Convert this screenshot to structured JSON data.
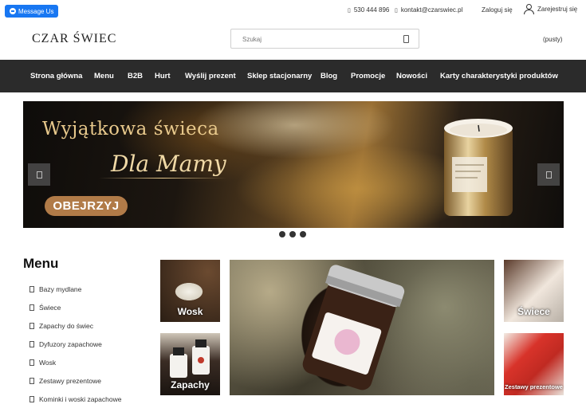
{
  "messenger": {
    "label": "Message Us"
  },
  "topbar": {
    "phone": "530 444 896",
    "email": "kontakt@czarswiec.pl",
    "login": "Zaloguj się",
    "register": "Zarejestruj się"
  },
  "header": {
    "logo": "CZAR ŚWIEC",
    "search_placeholder": "Szukaj",
    "cart": "(pusty)"
  },
  "nav": {
    "items": [
      "Strona główna",
      "Menu",
      "B2B",
      "Hurt",
      "Wyślij prezent",
      "Sklep stacjonarny",
      "Blog",
      "Promocje",
      "Nowości",
      "Karty charakterystyki produktów"
    ]
  },
  "banner": {
    "title": "Wyjątkowa świeca",
    "subtitle": "Dla Mamy",
    "button": "OBEJRZYJ"
  },
  "sidebar": {
    "title": "Menu",
    "items": [
      "Bazy mydlane",
      "Świece",
      "Zapachy do świec",
      "Dyfuzory zapachowe",
      "Wosk",
      "Zestawy prezentowe",
      "Kominki i woski zapachowe"
    ]
  },
  "tiles": {
    "wosk": "Wosk",
    "zapachy": "Zapachy",
    "swiece": "Świece",
    "zestawy": "Zestawy prezentowe"
  },
  "colors": {
    "nav_bg": "#2b2b2b",
    "banner_button": "#b17b48",
    "messenger": "#1877f2"
  }
}
